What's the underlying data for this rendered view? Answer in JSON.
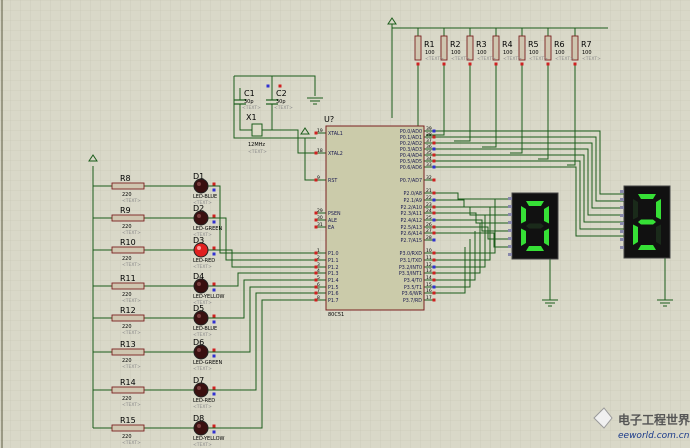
{
  "resistors_top": [
    {
      "name": "R1",
      "value": "100"
    },
    {
      "name": "R2",
      "value": "100"
    },
    {
      "name": "R3",
      "value": "100"
    },
    {
      "name": "R4",
      "value": "100"
    },
    {
      "name": "R5",
      "value": "100"
    },
    {
      "name": "R6",
      "value": "100"
    },
    {
      "name": "R7",
      "value": "100"
    }
  ],
  "text_placeholder": "<TEXT>",
  "capacitors": [
    {
      "name": "C1",
      "value": "30p"
    },
    {
      "name": "C2",
      "value": "30p"
    }
  ],
  "crystal": {
    "name": "X1",
    "value": "12MHz"
  },
  "mcu": {
    "ref": "U?",
    "part": "80C51",
    "left_pins": [
      {
        "num": "19",
        "label": "XTAL1"
      },
      {
        "num": "18",
        "label": "XTAL2"
      },
      {
        "num": "9",
        "label": "RST"
      },
      {
        "num": "29",
        "label": "PSEN"
      },
      {
        "num": "30",
        "label": "ALE"
      },
      {
        "num": "31",
        "label": "EA"
      },
      {
        "num": "1",
        "label": "P1.0"
      },
      {
        "num": "2",
        "label": "P1.1"
      },
      {
        "num": "3",
        "label": "P1.2"
      },
      {
        "num": "4",
        "label": "P1.3"
      },
      {
        "num": "5",
        "label": "P1.4"
      },
      {
        "num": "6",
        "label": "P1.5"
      },
      {
        "num": "7",
        "label": "P1.6"
      },
      {
        "num": "8",
        "label": "P1.7"
      }
    ],
    "right_pins": [
      {
        "num": "39",
        "label": "P0.0/AD0"
      },
      {
        "num": "38",
        "label": "P0.1/AD1"
      },
      {
        "num": "37",
        "label": "P0.2/AD2"
      },
      {
        "num": "36",
        "label": "P0.3/AD3"
      },
      {
        "num": "35",
        "label": "P0.4/AD4"
      },
      {
        "num": "34",
        "label": "P0.5/AD5"
      },
      {
        "num": "33",
        "label": "P0.6/AD6"
      },
      {
        "num": "32",
        "label": "P0.7/AD7"
      },
      {
        "num": "21",
        "label": "P2.0/A8"
      },
      {
        "num": "22",
        "label": "P2.1/A9"
      },
      {
        "num": "23",
        "label": "P2.2/A10"
      },
      {
        "num": "24",
        "label": "P2.3/A11"
      },
      {
        "num": "25",
        "label": "P2.4/A12"
      },
      {
        "num": "26",
        "label": "P2.5/A13"
      },
      {
        "num": "27",
        "label": "P2.6/A14"
      },
      {
        "num": "28",
        "label": "P2.7/A15"
      },
      {
        "num": "10",
        "label": "P3.0/RXD"
      },
      {
        "num": "11",
        "label": "P3.1/TXD"
      },
      {
        "num": "12",
        "label": "P3.2/INT0"
      },
      {
        "num": "13",
        "label": "P3.3/INT1"
      },
      {
        "num": "14",
        "label": "P3.4/T0"
      },
      {
        "num": "15",
        "label": "P3.5/T1"
      },
      {
        "num": "16",
        "label": "P3.6/WR"
      },
      {
        "num": "17",
        "label": "P3.7/RD"
      }
    ]
  },
  "led_rows": [
    {
      "res": "R8",
      "res_val": "220",
      "led": "D1",
      "led_type": "LED-BLUE",
      "lit": false
    },
    {
      "res": "R9",
      "res_val": "220",
      "led": "D2",
      "led_type": "LED-GREEN",
      "lit": false
    },
    {
      "res": "R10",
      "res_val": "220",
      "led": "D3",
      "led_type": "LED-RED",
      "lit": true
    },
    {
      "res": "R11",
      "res_val": "220",
      "led": "D4",
      "led_type": "LED-YELLOW",
      "lit": false
    },
    {
      "res": "R12",
      "res_val": "220",
      "led": "D5",
      "led_type": "LED-BLUE",
      "lit": false
    },
    {
      "res": "R13",
      "res_val": "220",
      "led": "D6",
      "led_type": "LED-GREEN",
      "lit": false
    },
    {
      "res": "R14",
      "res_val": "220",
      "led": "D7",
      "led_type": "LED-RED",
      "lit": false
    },
    {
      "res": "R15",
      "res_val": "220",
      "led": "D8",
      "led_type": "LED-YELLOW",
      "lit": false
    }
  ],
  "displays": [
    {
      "digit": "0"
    },
    {
      "digit": "2"
    }
  ],
  "watermark": {
    "cn": "电子工程世界",
    "url": "eeworld.com.cn"
  },
  "colors": {
    "background": "#d9d8c8",
    "grid": "#c4c3b2",
    "wire": "#1a5c1a",
    "chip_body": "#cbcbaa",
    "chip_border": "#7a2020",
    "text": "#1a1a50",
    "component_label": "#000000",
    "led_off": "#3a1010",
    "led_on": "#e02020",
    "segment_on": "#36e036",
    "segment_off": "#1a2a1a",
    "display_body": "#111111",
    "pin_red": "#d02020",
    "pin_blue": "#3030d0"
  }
}
